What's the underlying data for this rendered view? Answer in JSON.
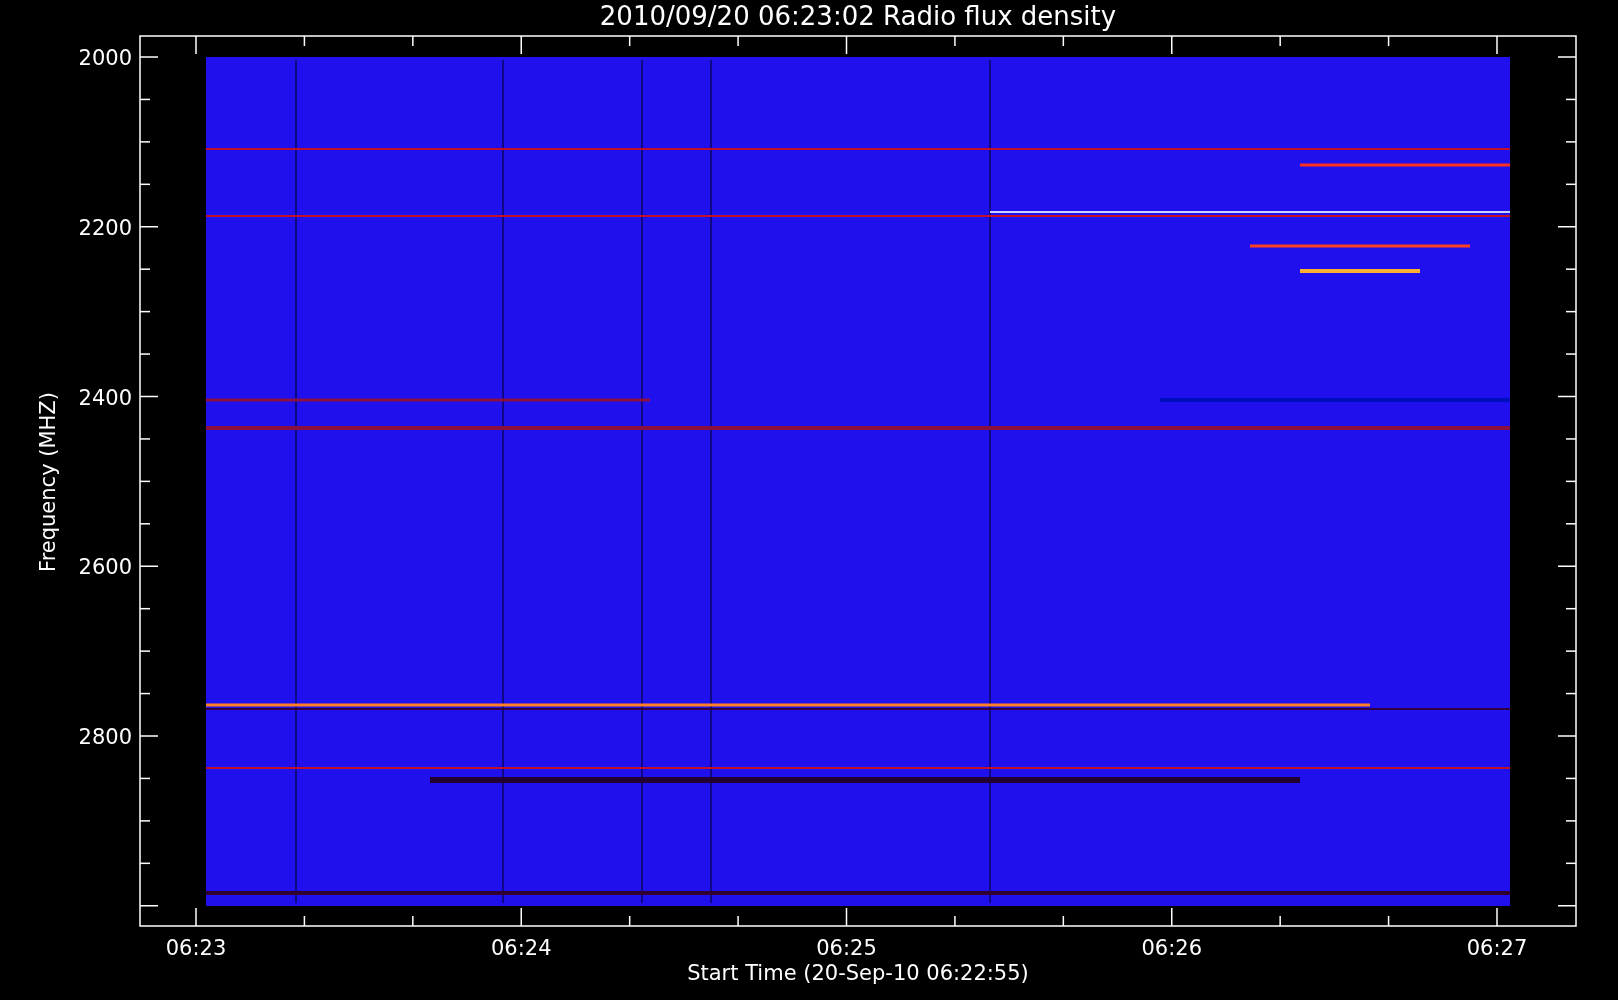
{
  "title": "2010/09/20 06:23:02 Radio flux density",
  "y_axis": {
    "label": "Frequency (MHZ)",
    "ticks": [
      "2000",
      "2200",
      "2400",
      "2600",
      "2800"
    ]
  },
  "x_axis": {
    "label": "Start Time (20-Sep-10 06:22:55)",
    "ticks": [
      "06:23",
      "06:24",
      "06:25",
      "06:26",
      "06:27"
    ]
  }
}
